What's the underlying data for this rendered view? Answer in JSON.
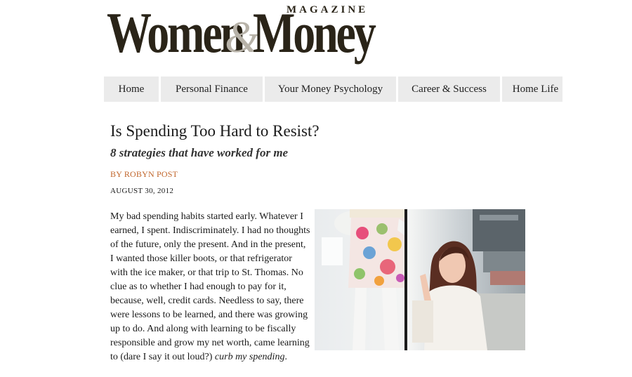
{
  "logo": {
    "word1": "Women",
    "ampersand": "&",
    "word2": "Money",
    "tagline": "MAGAZINE"
  },
  "nav": {
    "items": [
      {
        "label": "Home"
      },
      {
        "label": "Personal Finance"
      },
      {
        "label": "Your Money Psychology"
      },
      {
        "label": "Career & Success"
      },
      {
        "label": "Home Life"
      }
    ]
  },
  "article": {
    "title": "Is Spending Too Hard to Resist?",
    "subtitle": "8 strategies that have worked for me",
    "byline_prefix": "BY ",
    "author": "ROBYN POST",
    "date": "AUGUST 30, 2012",
    "body": "My bad spending habits started early. Whatever I earned, I spent. Indiscriminately. I had no thoughts of the future, only the present. And in the present, I wanted those killer boots, or that refrigerator with the ice maker, or that trip to St. Thomas. No clue as to whether I had enough to pay for it, because, well, credit cards. Needless to say, there were lessons to be learned, and there was growing up to do. And along with learning to be fiscally responsible and grow my net worth, came learning to (dare I say it out loud?) ",
    "body_emphasis": "curb my spending",
    "body_end": "."
  },
  "colors": {
    "accent": "#c1662c",
    "nav_bg": "#ebebeb",
    "logo_dark": "#2a2418",
    "logo_amp": "#b7b2a8"
  }
}
